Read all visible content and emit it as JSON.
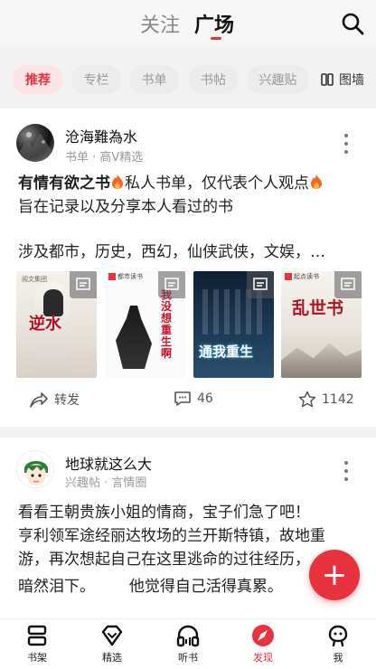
{
  "header": {
    "tabs": [
      {
        "label": "关注",
        "active": false
      },
      {
        "label": "广场",
        "active": true
      }
    ]
  },
  "chips": {
    "items": [
      "推荐",
      "专栏",
      "书单",
      "书帖",
      "兴趣贴"
    ],
    "active_index": 0,
    "gallery_label": "图墙"
  },
  "posts": [
    {
      "author": "沧海難為水",
      "meta": "书单 · 高V精选",
      "title": "有情有欲之书",
      "line1_rest": "私人书单，仅代表个人观点",
      "line2": "旨在记录以及分享本人看过的书",
      "line3": "涉及都市，历史，西幻，仙侠武侠，文娱，…",
      "covers": [
        {
          "publisher": "阅文集团",
          "title": "逆水"
        },
        {
          "publisher": "都市读书",
          "title": "我没想重生啊"
        },
        {
          "publisher": "",
          "title": "通我重生"
        },
        {
          "publisher": "起点读书",
          "title": "乱世书"
        }
      ],
      "share_label": "转发",
      "comments": "46",
      "likes": "1142"
    },
    {
      "author": "地球就这么大",
      "meta": "兴趣帖 · 言情圈",
      "lines": [
        "看看王朝贵族小姐的情商，宝子们急了吧！",
        "亨利领军途经丽达牧场的兰开斯特镇，故地重",
        "游，再次想起自己在这里逃命的过往经历，",
        "暗然泪下。       他觉得自己活得真累。"
      ]
    }
  ],
  "fab_label": "+",
  "nav": {
    "items": [
      {
        "label": "书架",
        "active": false
      },
      {
        "label": "精选",
        "active": false
      },
      {
        "label": "听书",
        "active": false
      },
      {
        "label": "发现",
        "active": true
      },
      {
        "label": "我",
        "active": false
      }
    ]
  },
  "colors": {
    "accent": "#e8323f",
    "flame": "#f26522"
  }
}
